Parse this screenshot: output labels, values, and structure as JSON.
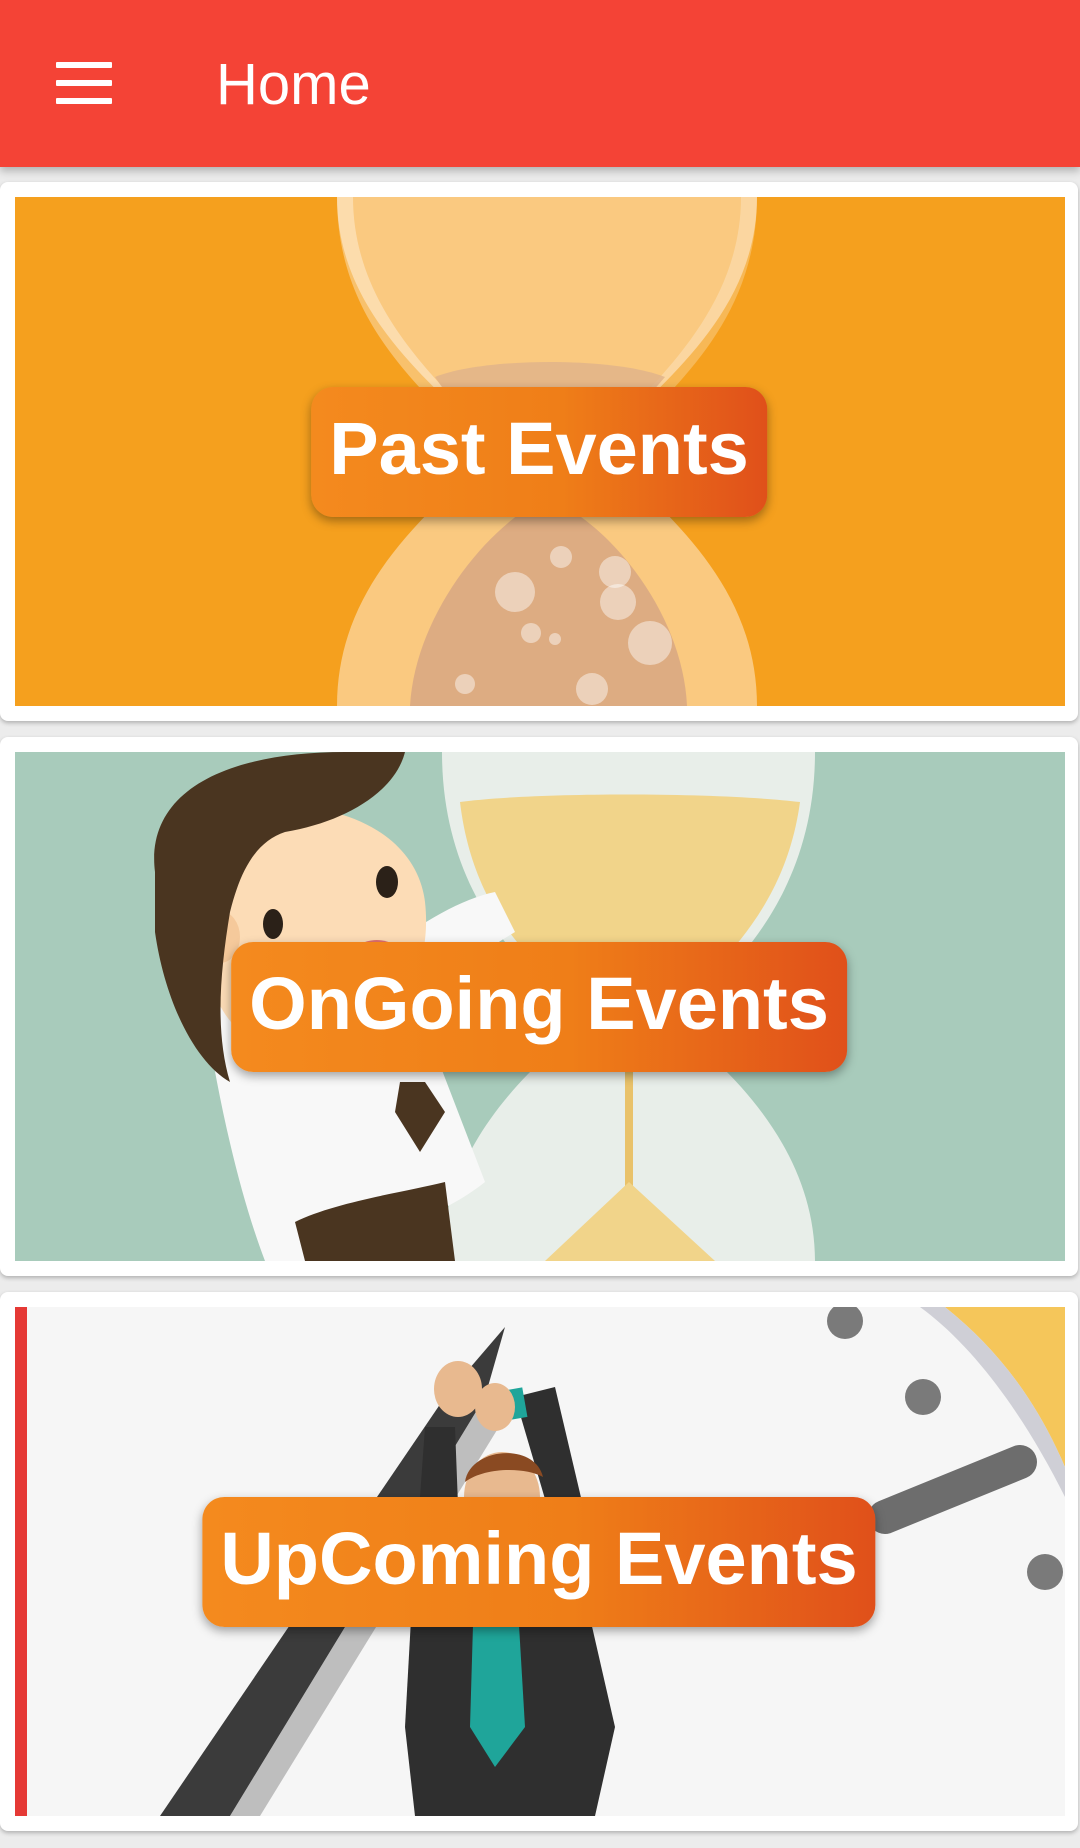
{
  "appbar": {
    "title": "Home",
    "color": "#f44336",
    "menu_icon": "hamburger-menu-icon"
  },
  "cards": [
    {
      "label": "Past Events",
      "illustration": "hourglass-bubbles",
      "background": "#f5a01e"
    },
    {
      "label": "OnGoing Events",
      "illustration": "man-holding-hourglass",
      "background": "#a8cbbb"
    },
    {
      "label": "UpComing Events",
      "illustration": "man-pushing-clock-hand",
      "background": "#f6f6f6"
    }
  ],
  "label_gradient": [
    "#f48a1e",
    "#e0501a"
  ]
}
